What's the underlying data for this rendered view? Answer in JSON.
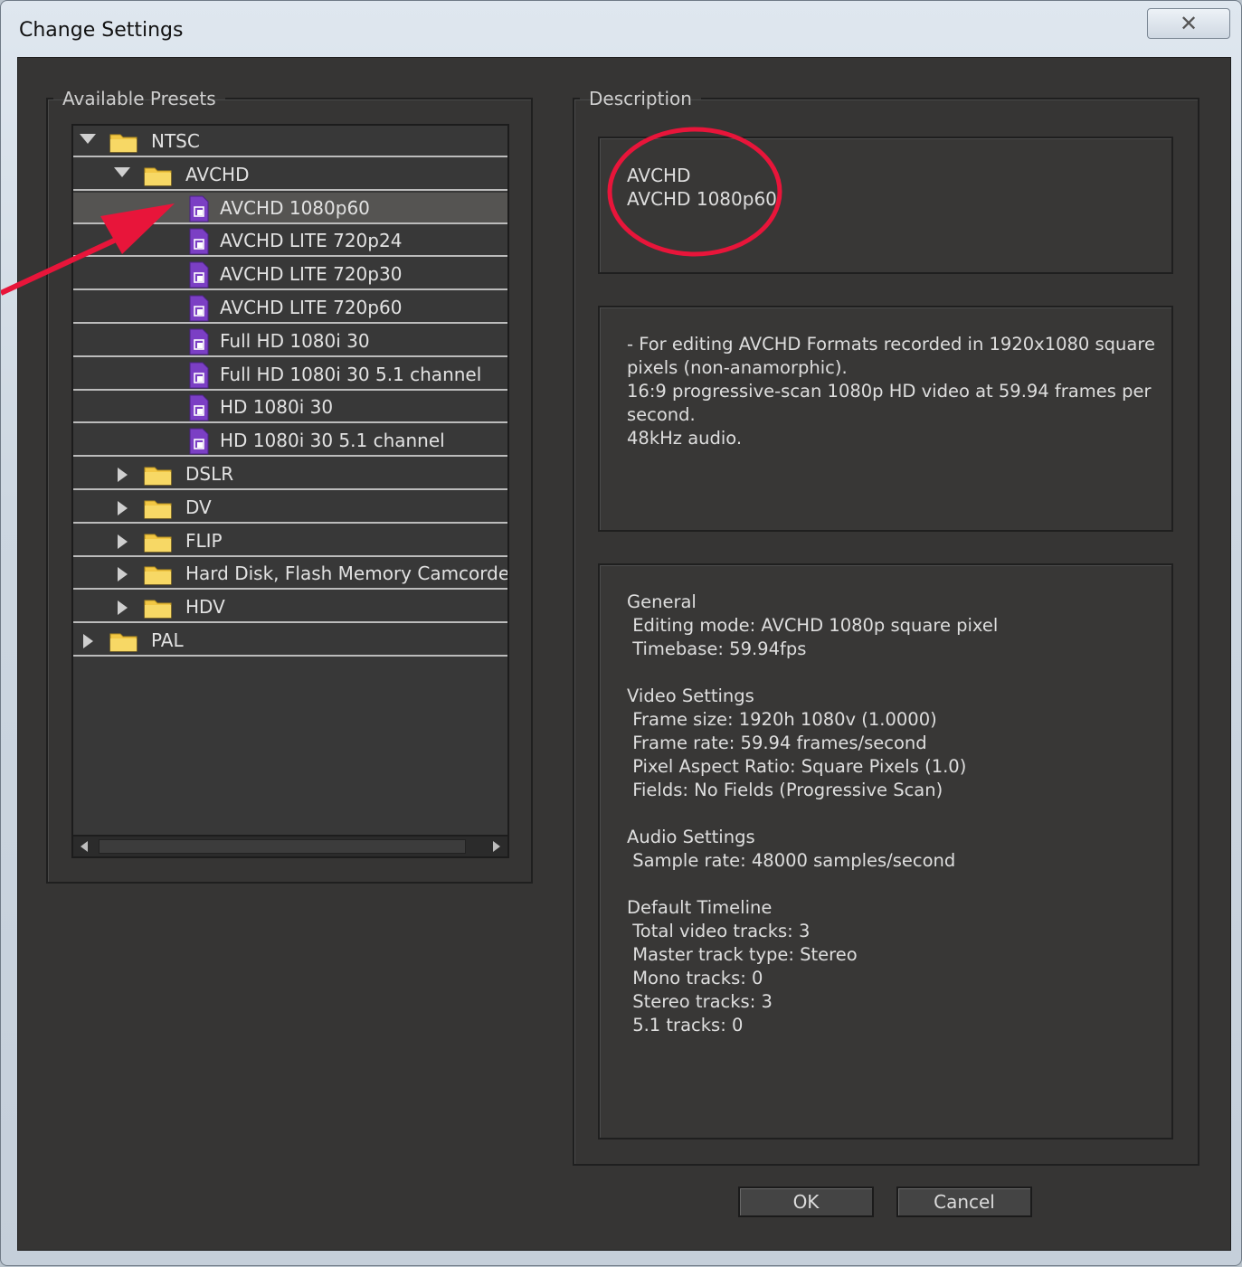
{
  "window": {
    "title": "Change Settings",
    "close_glyph": "✕"
  },
  "presets": {
    "legend": "Available Presets",
    "tree": [
      {
        "label": "NTSC",
        "level": 0,
        "type": "folder",
        "expanded": true
      },
      {
        "label": "AVCHD",
        "level": 1,
        "type": "folder",
        "expanded": true
      },
      {
        "label": "AVCHD 1080p60",
        "level": 2,
        "type": "preset",
        "selected": true
      },
      {
        "label": "AVCHD LITE 720p24",
        "level": 2,
        "type": "preset"
      },
      {
        "label": "AVCHD LITE 720p30",
        "level": 2,
        "type": "preset"
      },
      {
        "label": "AVCHD LITE 720p60",
        "level": 2,
        "type": "preset"
      },
      {
        "label": "Full HD 1080i 30",
        "level": 2,
        "type": "preset"
      },
      {
        "label": "Full HD 1080i 30 5.1 channel",
        "level": 2,
        "type": "preset"
      },
      {
        "label": "HD 1080i 30",
        "level": 2,
        "type": "preset"
      },
      {
        "label": "HD 1080i 30 5.1 channel",
        "level": 2,
        "type": "preset"
      },
      {
        "label": "DSLR",
        "level": 1,
        "type": "folder",
        "expanded": false
      },
      {
        "label": "DV",
        "level": 1,
        "type": "folder",
        "expanded": false
      },
      {
        "label": "FLIP",
        "level": 1,
        "type": "folder",
        "expanded": false
      },
      {
        "label": "Hard Disk, Flash Memory Camcorders",
        "level": 1,
        "type": "folder",
        "expanded": false
      },
      {
        "label": "HDV",
        "level": 1,
        "type": "folder",
        "expanded": false
      },
      {
        "label": "PAL",
        "level": 0,
        "type": "folder",
        "expanded": false
      }
    ]
  },
  "description": {
    "legend": "Description",
    "name_lines": [
      "AVCHD",
      "AVCHD 1080p60"
    ],
    "text": "- For editing AVCHD Formats recorded in 1920x1080 square pixels (non-anamorphic).\n16:9 progressive-scan 1080p HD video at 59.94 frames per second.\n48kHz audio.",
    "specs": [
      "General",
      " Editing mode: AVCHD 1080p square pixel",
      " Timebase: 59.94fps",
      "",
      "Video Settings",
      " Frame size: 1920h 1080v (1.0000)",
      " Frame rate: 59.94 frames/second",
      " Pixel Aspect Ratio: Square Pixels (1.0)",
      " Fields: No Fields (Progressive Scan)",
      "",
      "Audio Settings",
      " Sample rate: 48000 samples/second",
      "",
      "Default Timeline",
      " Total video tracks: 3",
      " Master track type: Stereo",
      " Mono tracks: 0",
      " Stereo tracks: 3",
      " 5.1 tracks: 0"
    ]
  },
  "buttons": {
    "ok": "OK",
    "cancel": "Cancel"
  },
  "colors": {
    "annotation": "#e8153a",
    "folder": "#f2c744",
    "preset": "#7b3fc4"
  }
}
